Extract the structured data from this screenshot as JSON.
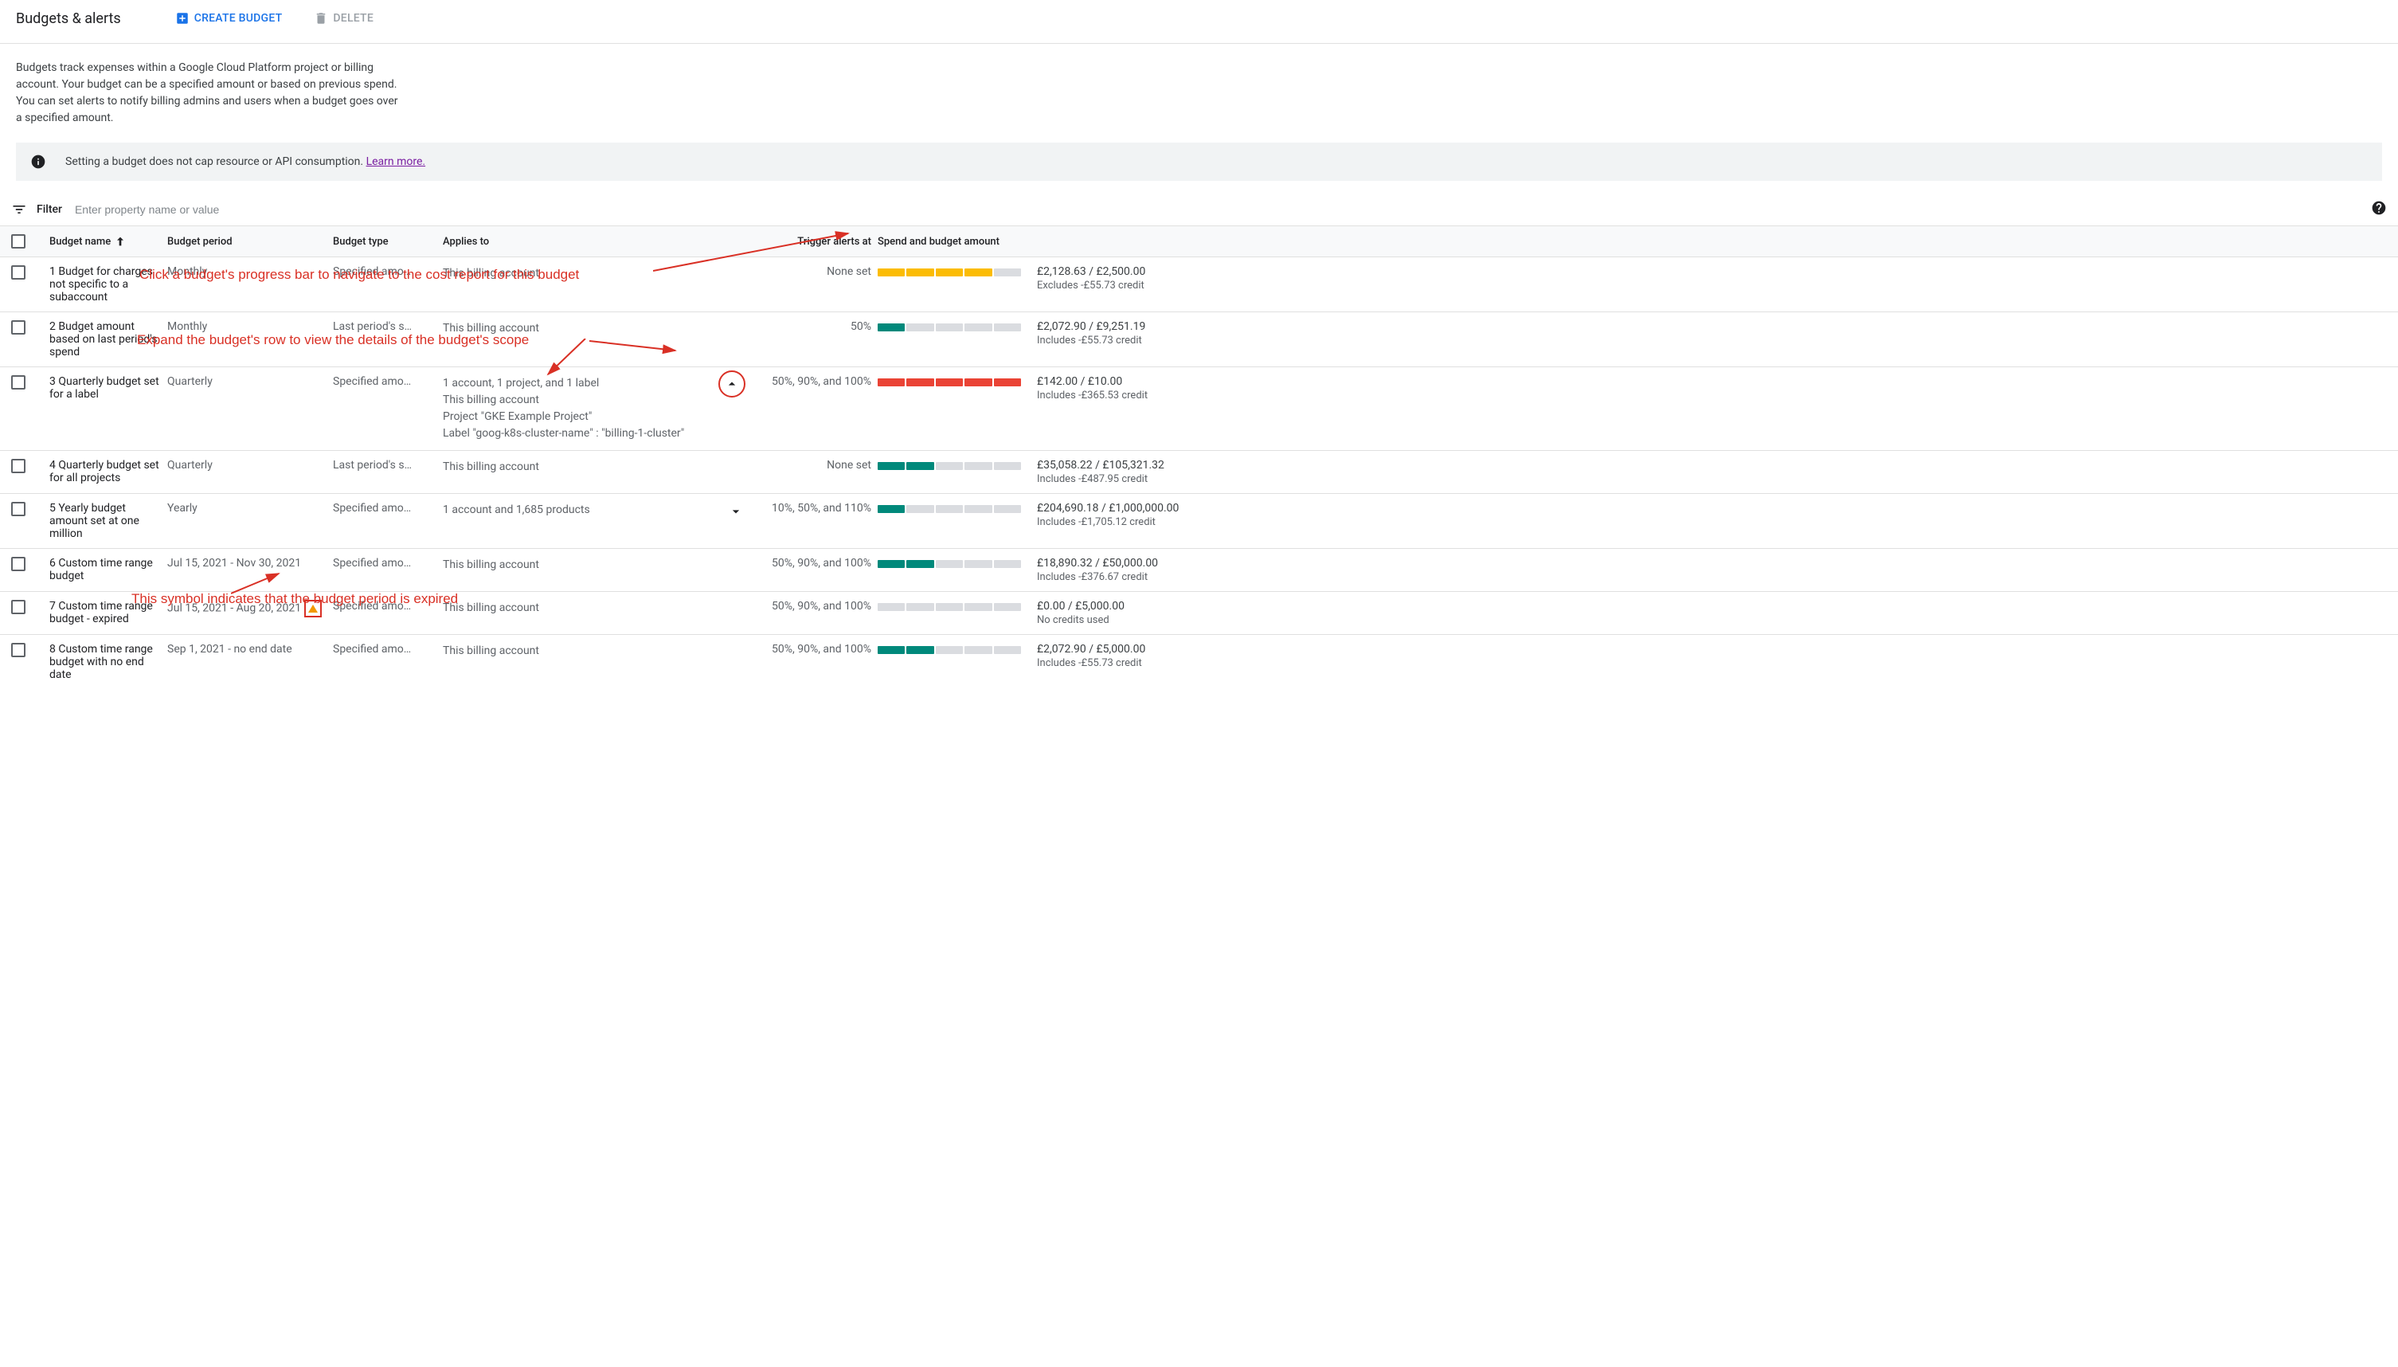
{
  "header": {
    "title": "Budgets & alerts",
    "create_label": "CREATE BUDGET",
    "delete_label": "DELETE"
  },
  "description": "Budgets track expenses within a Google Cloud Platform project or billing account. Your budget can be a specified amount or based on previous spend. You can set alerts to notify billing admins and users when a budget goes over a specified amount.",
  "info_banner": {
    "text": "Setting a budget does not cap resource or API consumption. ",
    "link_text": "Learn more."
  },
  "filter": {
    "label": "Filter",
    "placeholder": "Enter property name or value"
  },
  "columns": {
    "name": "Budget name",
    "period": "Budget period",
    "type": "Budget type",
    "applies": "Applies to",
    "trigger": "Trigger alerts at",
    "spend": "Spend and budget amount"
  },
  "rows": [
    {
      "name": "1 Budget for charges not specific to a subaccount",
      "period": "Monthly",
      "type": "Specified amo…",
      "applies": [
        "This billing account"
      ],
      "expand": "none",
      "trigger": "None set",
      "progress": {
        "segments": [
          "yellow",
          "yellow",
          "yellow",
          "yellow",
          "light"
        ]
      },
      "spend": "£2,128.63 / £2,500.00",
      "note": "Excludes -£55.73 credit"
    },
    {
      "name": "2 Budget amount based on last period's spend",
      "period": "Monthly",
      "type": "Last period's s…",
      "applies": [
        "This billing account"
      ],
      "expand": "none",
      "trigger": "50%",
      "progress": {
        "segments": [
          "teal",
          "light",
          "light",
          "light",
          "light"
        ]
      },
      "spend": "£2,072.90 / £9,251.19",
      "note": "Includes -£55.73 credit"
    },
    {
      "name": "3 Quarterly budget set for a label",
      "period": "Quarterly",
      "type": "Specified amo…",
      "applies": [
        "1 account, 1 project, and 1 label",
        "This billing account",
        "Project \"GKE Example Project\"",
        "Label \"goog-k8s-cluster-name\" : \"billing-1-cluster\""
      ],
      "expand": "up",
      "trigger": "50%, 90%, and 100%",
      "progress": {
        "segments": [
          "orange",
          "orange",
          "orange",
          "orange",
          "orange"
        ]
      },
      "spend": "£142.00 / £10.00",
      "note": "Includes -£365.53 credit"
    },
    {
      "name": "4 Quarterly budget set for all projects",
      "period": "Quarterly",
      "type": "Last period's s…",
      "applies": [
        "This billing account"
      ],
      "expand": "none",
      "trigger": "None set",
      "progress": {
        "segments": [
          "teal",
          "teal",
          "light",
          "light",
          "light"
        ]
      },
      "spend": "£35,058.22 / £105,321.32",
      "note": "Includes -£487.95 credit"
    },
    {
      "name": "5 Yearly budget amount set at one million",
      "period": "Yearly",
      "type": "Specified amo…",
      "applies": [
        "1 account and 1,685 products"
      ],
      "expand": "down",
      "trigger": "10%, 50%, and 110%",
      "progress": {
        "segments": [
          "teal",
          "light",
          "light",
          "light",
          "light"
        ]
      },
      "spend": "£204,690.18 / £1,000,000.00",
      "note": "Includes -£1,705.12 credit"
    },
    {
      "name": "6 Custom time range budget",
      "period": "Jul 15, 2021 - Nov 30, 2021",
      "type": "Specified amo…",
      "applies": [
        "This billing account"
      ],
      "expand": "none",
      "trigger": "50%, 90%, and 100%",
      "progress": {
        "segments": [
          "teal",
          "teal",
          "light",
          "light",
          "light"
        ]
      },
      "spend": "£18,890.32 / £50,000.00",
      "note": "Includes -£376.67 credit"
    },
    {
      "name": "7 Custom time range budget - expired",
      "period": "Jul 15, 2021 - Aug 20, 2021",
      "period_warning": true,
      "type": "Specified amo…",
      "applies": [
        "This billing account"
      ],
      "expand": "none",
      "trigger": "50%, 90%, and 100%",
      "progress": {
        "segments": [
          "light",
          "light",
          "light",
          "light",
          "light"
        ]
      },
      "spend": "£0.00 / £5,000.00",
      "note": "No credits used"
    },
    {
      "name": "8 Custom time range budget with no end date",
      "period": "Sep 1, 2021 - no end date",
      "type": "Specified amo…",
      "applies": [
        "This billing account"
      ],
      "expand": "none",
      "trigger": "50%, 90%, and 100%",
      "progress": {
        "segments": [
          "teal",
          "teal",
          "light",
          "light",
          "light"
        ]
      },
      "spend": "£2,072.90 / £5,000.00",
      "note": "Includes -£55.73 credit"
    }
  ],
  "annotations": {
    "progress_tip": "Click a budget's progress bar to navigate to the cost report for this budget",
    "expand_tip": "Expand the budget's row to view the details of the budget's scope",
    "expired_tip": "This symbol indicates that the budget period is expired"
  }
}
